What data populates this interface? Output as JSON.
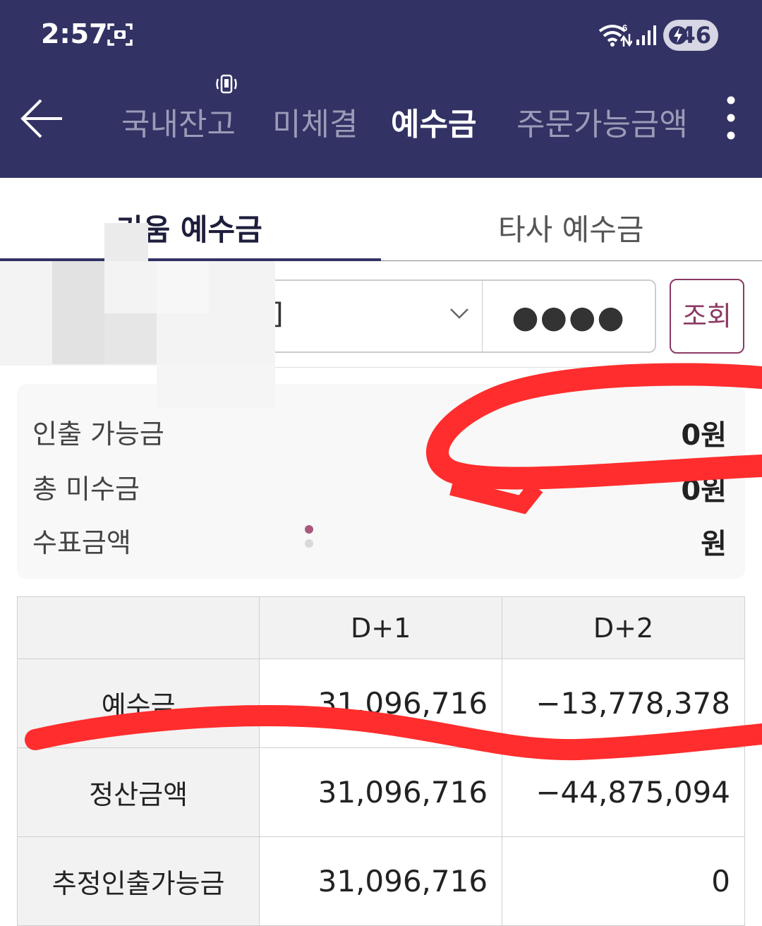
{
  "status_bar": {
    "time": "2:57",
    "battery": "46",
    "icons": [
      "screenshot-icon",
      "wifi-icon",
      "signal-icon",
      "battery-charging-icon"
    ]
  },
  "nav": {
    "tabs": [
      {
        "label": "국내잔고",
        "active": false
      },
      {
        "label": "미체결",
        "active": false
      },
      {
        "label": "예수금",
        "active": true
      },
      {
        "label": "주문가능금액",
        "active": false
      }
    ]
  },
  "subtabs": [
    {
      "label": "키움 예수금",
      "active": true
    },
    {
      "label": "타사 예수금",
      "active": false
    }
  ],
  "account": {
    "value_fragment": "]",
    "password_mask": "●●●●",
    "query_label": "조회"
  },
  "summary": [
    {
      "label": "인출 가능금",
      "value": "0원"
    },
    {
      "label": "총 미수금",
      "value": "0원"
    },
    {
      "label": "수표금액",
      "value": "원"
    }
  ],
  "table": {
    "headers": [
      "",
      "D+1",
      "D+2"
    ],
    "rows": [
      {
        "label": "예수금",
        "d1": "31,096,716",
        "d2": "−13,778,378"
      },
      {
        "label": "정산금액",
        "d1": "31,096,716",
        "d2": "−44,875,094"
      },
      {
        "label": "추정인출가능금",
        "d1": "31,096,716",
        "d2": "0"
      }
    ]
  },
  "colors": {
    "header_bg": "#323264",
    "accent": "#8a3a63",
    "scribble": "#ff2d2d"
  }
}
